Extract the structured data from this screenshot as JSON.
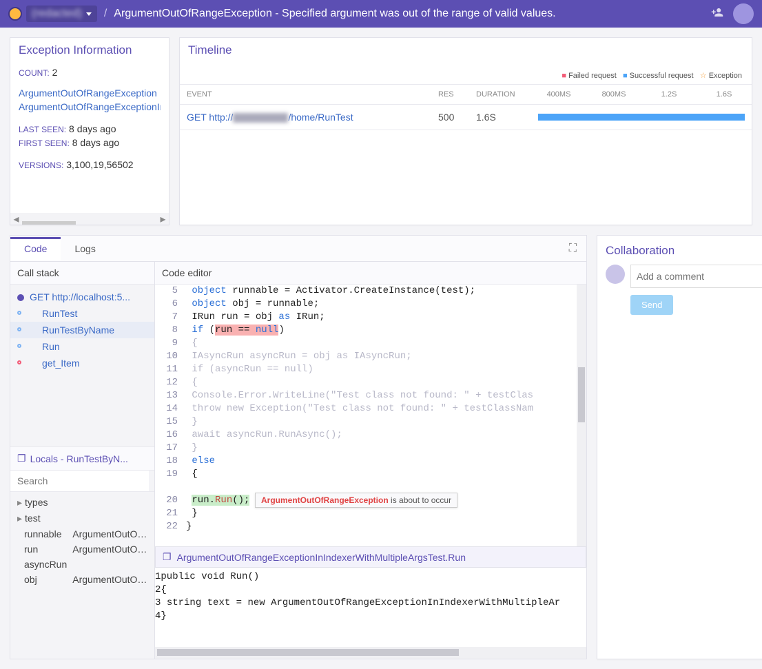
{
  "header": {
    "project": "(redacted)",
    "title": "ArgumentOutOfRangeException - Specified argument was out of the range of valid values."
  },
  "exception_info": {
    "heading": "Exception Information",
    "count_label": "COUNT:",
    "count": "2",
    "lines": [
      "ArgumentOutOfRangeException",
      "ArgumentOutOfRangeExceptionInIndexer"
    ],
    "last_seen_label": "LAST SEEN:",
    "last_seen": "8 days ago",
    "first_seen_label": "FIRST SEEN:",
    "first_seen": "8 days ago",
    "versions_label": "VERSIONS:",
    "versions": "3,100,19,56502"
  },
  "timeline": {
    "heading": "Timeline",
    "legend": {
      "failed": "Failed request",
      "success": "Successful request",
      "exception": "Exception"
    },
    "cols": {
      "event": "Event",
      "res": "Res",
      "duration": "Duration",
      "t1": "400ms",
      "t2": "800ms",
      "t3": "1.2s",
      "t4": "1.6s"
    },
    "row": {
      "event_prefix": "GET http://",
      "event_suffix": "/home/RunTest",
      "res": "500",
      "duration": "1.6S"
    }
  },
  "tabs": {
    "code": "Code",
    "logs": "Logs"
  },
  "callstack": {
    "heading": "Call stack",
    "items": [
      "GET http://localhost:5...",
      "RunTest",
      "RunTestByName",
      "Run",
      "get_Item"
    ]
  },
  "locals": {
    "heading": "Locals - RunTestByN...",
    "search_placeholder": "Search",
    "rows": [
      {
        "k": "types",
        "v": "",
        "tri": true
      },
      {
        "k": "test",
        "v": "",
        "tri": true
      },
      {
        "k": "runnable",
        "v": "ArgumentOutOfRange",
        "indent": true
      },
      {
        "k": "run",
        "v": "ArgumentOutOfRange",
        "indent": true
      },
      {
        "k": "asyncRun",
        "v": "",
        "indent": true
      },
      {
        "k": "obj",
        "v": "ArgumentOutOfRange",
        "indent": true
      }
    ]
  },
  "editor": {
    "heading": "Code editor",
    "tooltip_bold": "ArgumentOutOfRangeException",
    "tooltip_text": " is about to occur",
    "file_bar": "ArgumentOutOfRangeExceptionInIndexerWithMultipleArgsTest.Run"
  },
  "code_main": [
    {
      "n": 5,
      "raw": "        <span class='kw'>object</span> runnable = Activator.CreateInstance(test);"
    },
    {
      "n": 6,
      "raw": "        <span class='kw'>object</span> obj = runnable;"
    },
    {
      "n": 7,
      "raw": "        IRun run = obj <span class='kw'>as</span> IRun;"
    },
    {
      "n": 8,
      "raw": "        <span class='kw'>if</span> (<span class='hl-red'>run == <span class='kw'>null</span></span>)"
    },
    {
      "n": 9,
      "raw": "        <span class='cm'>{</span>"
    },
    {
      "n": 10,
      "raw": "            <span class='cm'>IAsyncRun asyncRun = obj as IAsyncRun;</span>"
    },
    {
      "n": 11,
      "raw": "            <span class='cm'>if (asyncRun == null)</span>"
    },
    {
      "n": 12,
      "raw": "            <span class='cm'>{</span>"
    },
    {
      "n": 13,
      "raw": "                <span class='cm'>Console.Error.WriteLine(\"Test class not found: \" + testClas</span>"
    },
    {
      "n": 14,
      "raw": "                <span class='cm'>throw new Exception(\"Test class not found: \" + testClassNam</span>"
    },
    {
      "n": 15,
      "raw": "            <span class='cm'>}</span>"
    },
    {
      "n": 16,
      "raw": "            <span class='cm'>await asyncRun.RunAsync();</span>"
    },
    {
      "n": 17,
      "raw": "        <span class='cm'>}</span>"
    },
    {
      "n": 18,
      "raw": "        <span class='kw'>else</span>"
    },
    {
      "n": 19,
      "raw": "        {"
    },
    {
      "n": "",
      "raw": ""
    },
    {
      "n": 20,
      "raw": "            <span class='hl-grn'>run.<span style='color:#c2473e'>Run</span>();</span>"
    },
    {
      "n": 21,
      "raw": "        }"
    },
    {
      "n": 22,
      "raw": "}"
    }
  ],
  "code_run": [
    {
      "n": 1,
      "raw": "<span class='kw'>public</span> <span class='kw'>void</span> Run()"
    },
    {
      "n": 2,
      "raw": "{"
    },
    {
      "n": "",
      "raw": ""
    },
    {
      "n": 3,
      "raw": "    <span class='hl-grn'><span class='kw'>string</span> text = <span class='kw'>new</span> ArgumentOutOfRangeExceptionInIndexerWithMultipleAr</span>"
    },
    {
      "n": 4,
      "raw": "}"
    }
  ],
  "collab": {
    "heading": "Collaboration",
    "placeholder": "Add a comment",
    "send": "Send"
  }
}
